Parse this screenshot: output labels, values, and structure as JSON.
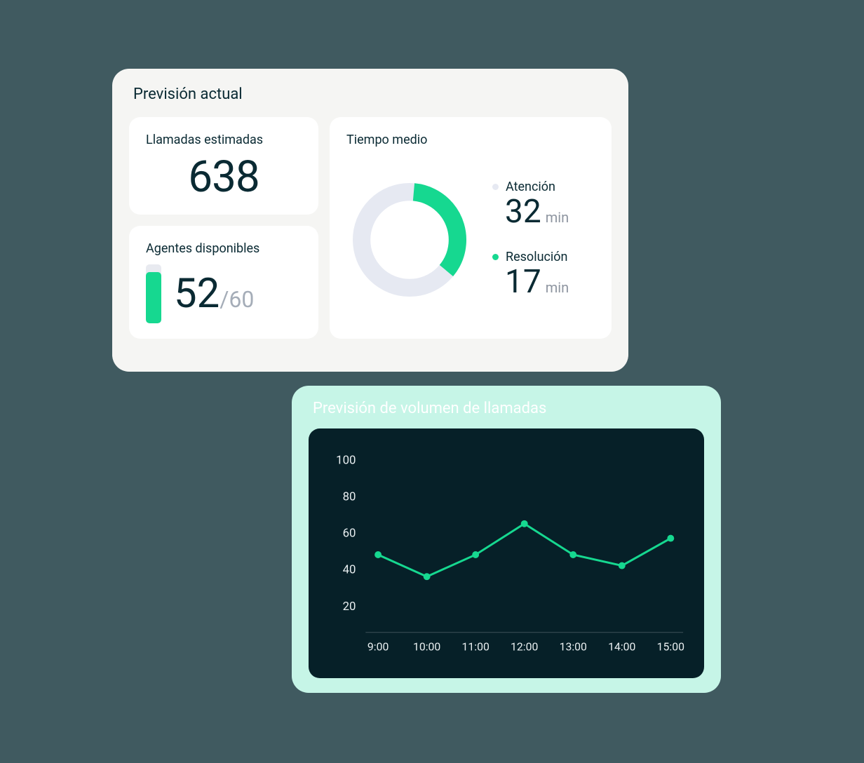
{
  "forecast": {
    "title": "Previsión actual",
    "calls": {
      "label": "Llamadas estimadas",
      "value": "638"
    },
    "agents": {
      "label": "Agentes disponibles",
      "value": "52",
      "total": "/60",
      "fill_pct": 86.7
    },
    "avg_time": {
      "label": "Tiempo medio",
      "unit": "min",
      "attention": {
        "label": "Atención",
        "value": "32",
        "color": "#e6e9f2"
      },
      "resolution": {
        "label": "Resolución",
        "value": "17",
        "color": "#16d890"
      }
    }
  },
  "volume": {
    "title": "Previsión de volumen de llamadas"
  },
  "colors": {
    "accent": "#16d890",
    "light": "#e6e9f2",
    "dark": "#062028"
  },
  "chart_data": {
    "type": "line",
    "title": "Previsión de volumen de llamadas",
    "xlabel": "",
    "ylabel": "",
    "categories": [
      "9:00",
      "10:00",
      "11:00",
      "12:00",
      "13:00",
      "14:00",
      "15:00"
    ],
    "values": [
      48,
      36,
      48,
      65,
      48,
      42,
      57
    ],
    "y_ticks": [
      20,
      40,
      60,
      80,
      100
    ],
    "ylim": [
      10,
      105
    ]
  }
}
